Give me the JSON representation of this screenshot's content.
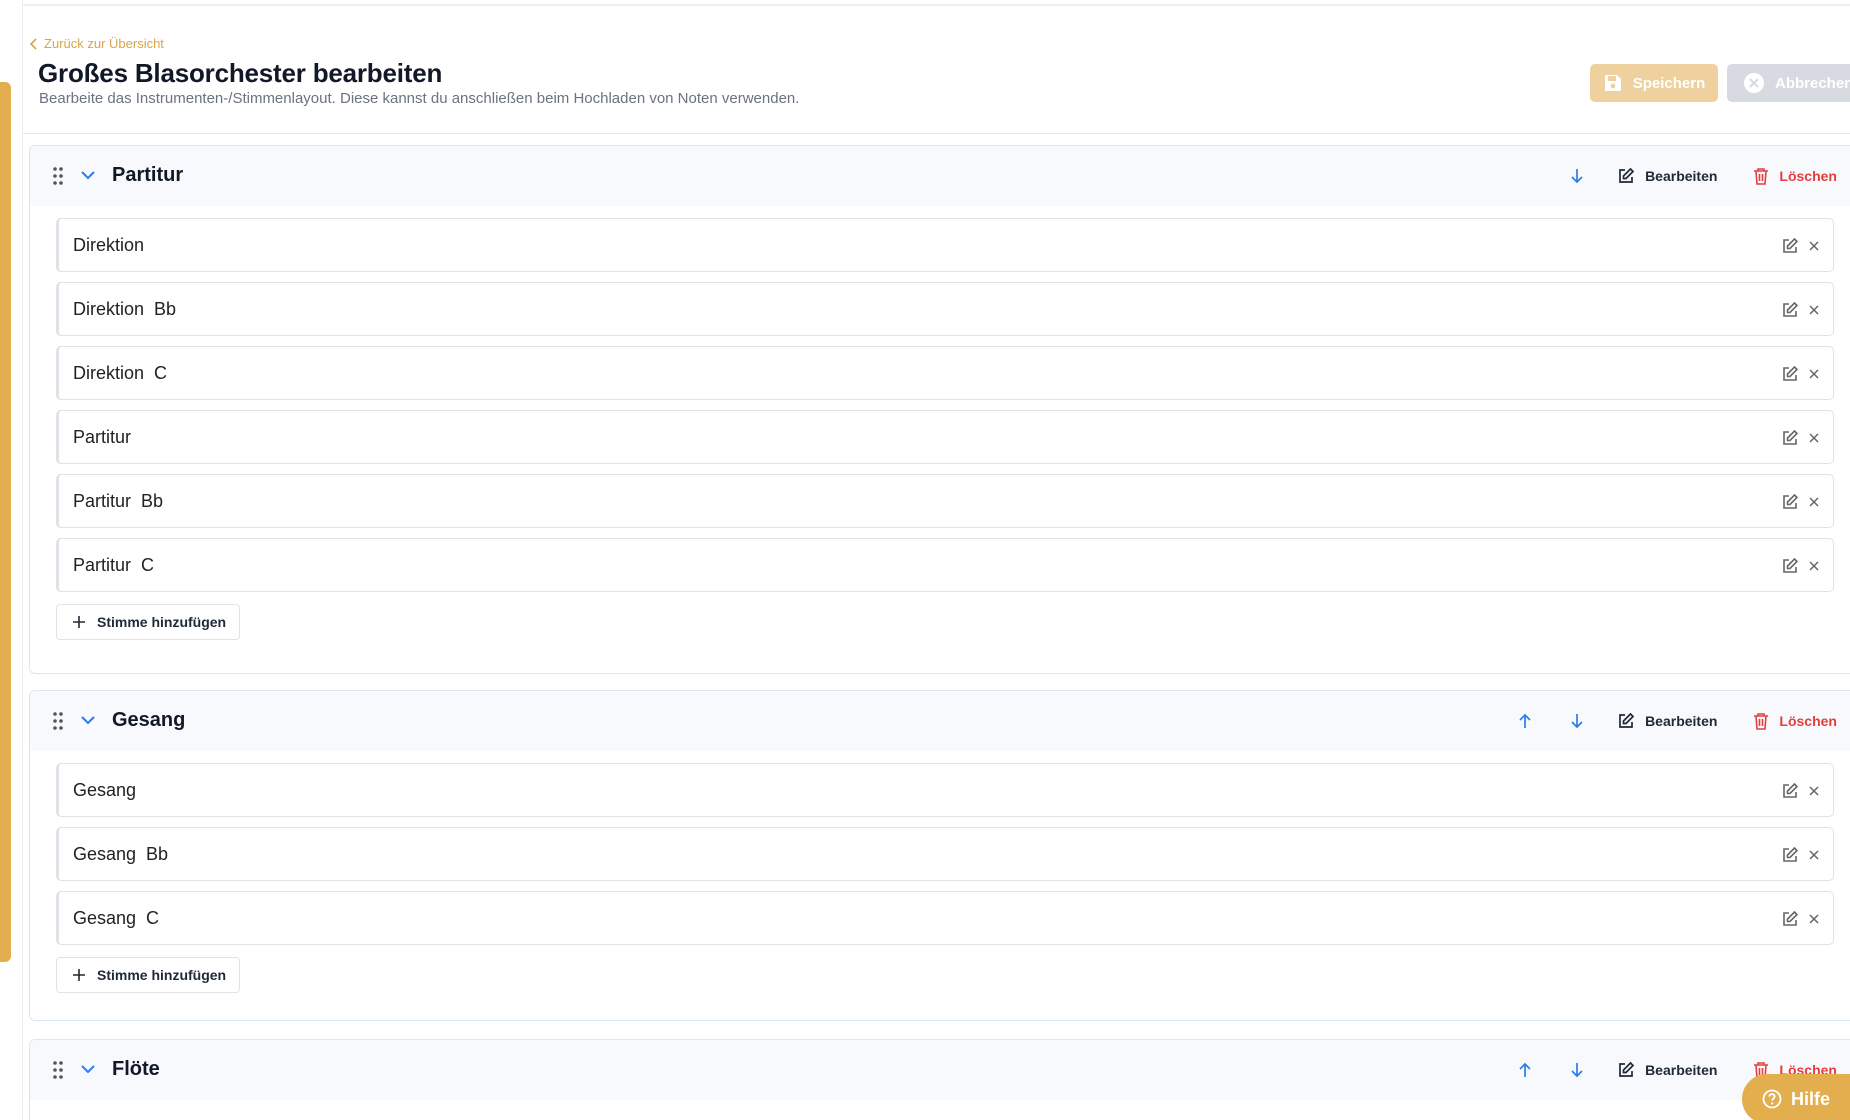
{
  "header": {
    "back_label": "Zurück zur Übersicht",
    "title": "Großes Blasorchester bearbeiten",
    "subtitle": "Bearbeite das Instrumenten-/Stimmenlayout. Diese kannst du anschließen beim Hochladen von Noten verwenden.",
    "save_label": "Speichern",
    "cancel_label": "Abbrechen"
  },
  "actions": {
    "edit_label": "Bearbeiten",
    "delete_label": "Löschen",
    "add_voice_label": "Stimme hinzufügen"
  },
  "groups": [
    {
      "title": "Partitur",
      "voices": [
        "Direktion",
        "Direktion  Bb",
        "Direktion  C",
        "Partitur",
        "Partitur  Bb",
        "Partitur  C"
      ]
    },
    {
      "title": "Gesang",
      "voices": [
        "Gesang",
        "Gesang  Bb",
        "Gesang  C"
      ]
    },
    {
      "title": "Flöte",
      "voices": []
    }
  ],
  "help": {
    "label": "Hilfe"
  },
  "colors": {
    "accent": "#e3ae4e",
    "link_blue": "#2b7de9",
    "danger": "#e53e3e",
    "group_border": "#dce6f5"
  }
}
